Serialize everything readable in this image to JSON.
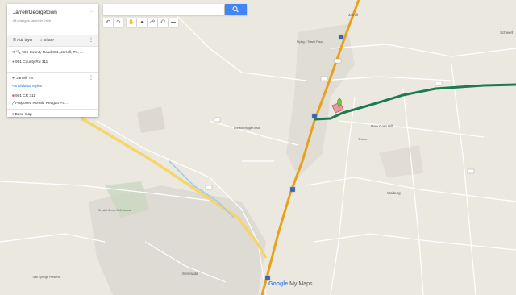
{
  "panel": {
    "title": "Jarrell/Georgetown",
    "saved": "All changes saved in Drive",
    "add_layer": "Add layer",
    "share": "Share",
    "layer1": {
      "search_text": "901 County Road 311, Jarrell, TX, ...",
      "item": "901 County Rd 311"
    },
    "layer2": {
      "name": "Jarrell, TX",
      "style": "Individual styles",
      "item1": "901 CR 311",
      "item2": "Proposed Ronald Reagan Pa..."
    },
    "base_map": "Base map"
  },
  "search": {
    "placeholder": ""
  },
  "attribution": {
    "google": "Google",
    "mymaps": "My Maps"
  },
  "map_labels": [
    {
      "text": "Jarrell"
    },
    {
      "text": "Flying J Travel Plaza"
    },
    {
      "text": "New Corn Hill"
    },
    {
      "text": "Theon"
    },
    {
      "text": "Walburg"
    },
    {
      "text": "Serenada"
    },
    {
      "text": "Schwert"
    },
    {
      "text": "Ronald Reagan Blvd"
    },
    {
      "text": "Crystal Creek Golf Course"
    },
    {
      "text": "Twin Springs Preserve"
    }
  ],
  "colors": {
    "interstate": "#e8a11d",
    "route": "#1b7a4e",
    "water": "#9ecbe8",
    "panel_accent": "#1a73e8"
  }
}
